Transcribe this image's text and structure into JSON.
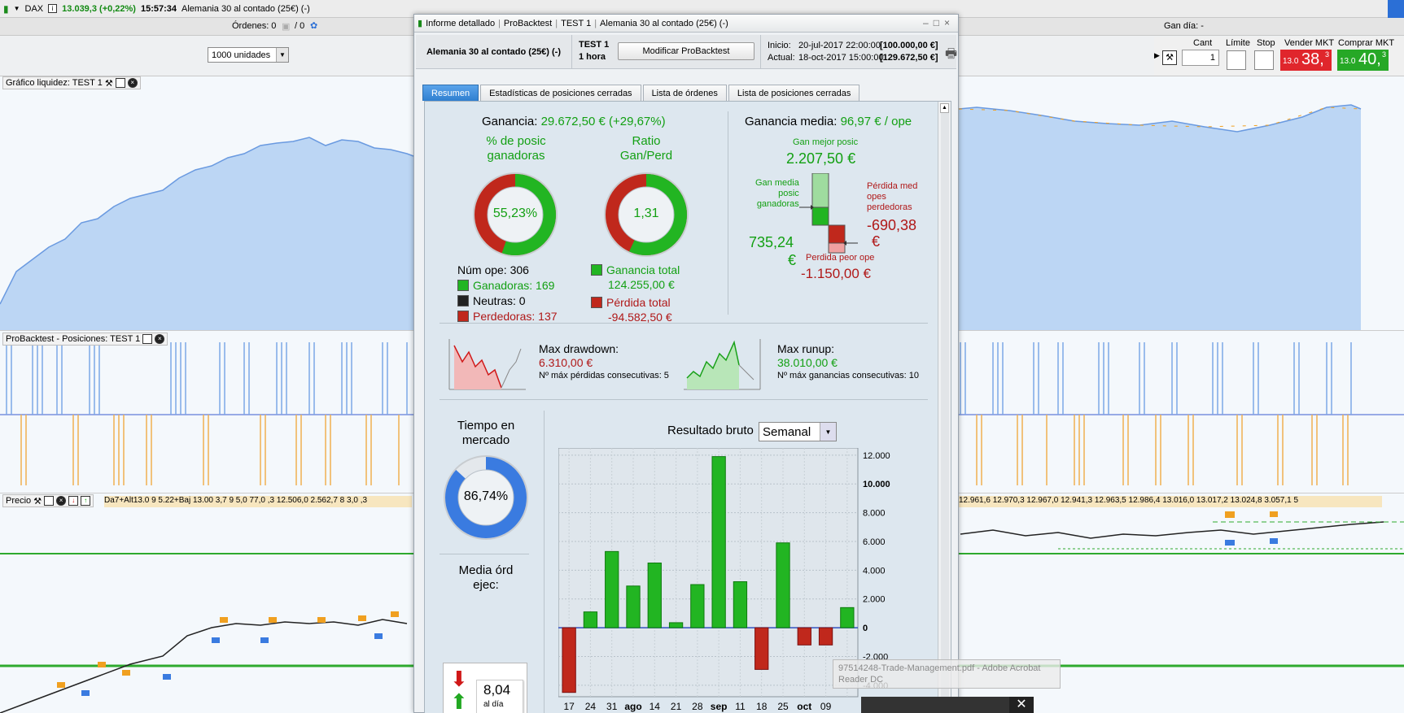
{
  "topbar": {
    "symbol": "DAX",
    "price": "13.039,3 (+0,22%)",
    "time": "15:57:34",
    "instrument": "Alemania 30 al contado (25€) (-)",
    "orders_label": "Órdenes: 0",
    "orders_sep": "/ 0",
    "gan_dia": "Gan día: -"
  },
  "units_select": "1000 unidades",
  "trade": {
    "cant_label": "Cant",
    "cant_value": "1",
    "limite_label": "Límite",
    "stop_label": "Stop",
    "sell_label": "Vender MKT",
    "sell_small": "13.0",
    "sell_big": "38,",
    "sell_sup": "3",
    "buy_label": "Comprar MKT",
    "buy_small": "13.0",
    "buy_big": "40,",
    "buy_sup": "3"
  },
  "panes": {
    "equity_label": "Gráfico liquidez: TEST 1",
    "positions_label": "ProBacktest - Posiciones: TEST 1",
    "price_label": "Precio",
    "price_overlay": "Da7+Alt13.0 9 5.22+Baj 13.00 3,7 9 5,0 77,0 ,3 12.506,0 2.562,7 8 3,0 ,3",
    "price_ticker_right": "12.961,6  12.970,3  12.967,0  12.941,3  12.963,5  12.986,4  13.016,0  13.017,2  13.024,8  3.057,1  5"
  },
  "dialog": {
    "title_parts": [
      "Informe detallado",
      "ProBacktest",
      "TEST 1",
      "Alemania 30 al contado (25€) (-)"
    ],
    "instrument": "Alemania 30 al contado (25€) (-)",
    "test_name": "TEST 1",
    "timeframe": "1 hora",
    "modify_button": "Modificar ProBacktest",
    "inicio_label": "Inicio:",
    "inicio_date": "20-jul-2017 22:00:00",
    "inicio_value": "[100.000,00 €]",
    "actual_label": "Actual:",
    "actual_date": "18-oct-2017 15:00:00",
    "actual_value": "[129.672,50 €]",
    "tabs": [
      "Resumen",
      "Estadísticas de posiciones cerradas",
      "Lista de órdenes",
      "Lista de posiciones cerradas"
    ],
    "ganancia_label": "Ganancia:",
    "ganancia_value": "29.672,50 € (+29,67%)",
    "pct_label_1": "% de posic",
    "pct_label_2": "ganadoras",
    "pct_value": "55,23%",
    "pct_fraction": 0.5523,
    "ratio_label_1": "Ratio",
    "ratio_label_2": "Gan/Perd",
    "ratio_value": "1,31",
    "ratio_fraction": 0.568,
    "num_ope": "Núm ope: 306",
    "ganadoras": "Ganadoras: 169",
    "neutras": "Neutras: 0",
    "perdedoras": "Perdedoras: 137",
    "ganancia_total_label": "Ganancia total",
    "ganancia_total_value": "124.255,00 €",
    "perdida_total_label": "Pérdida total",
    "perdida_total_value": "-94.582,50 €",
    "ganancia_media_label": "Ganancia media:",
    "ganancia_media_value": "96,97 € / ope",
    "gan_mejor_label": "Gan mejor posic",
    "gan_mejor_value": "2.207,50 €",
    "gan_media_label_1": "Gan media",
    "gan_media_label_2": "posic",
    "gan_media_label_3": "ganadoras",
    "gan_media_value_1": "735,24",
    "gan_media_value_2": "€",
    "perdida_med_label_1": "Pérdida med",
    "perdida_med_label_2": "opes",
    "perdida_med_label_3": "perdedoras",
    "perdida_med_value_1": "-690,38",
    "perdida_med_value_2": "€",
    "perdida_peor_label": "Perdida peor ope",
    "perdida_peor_value": "-1.150,00 €",
    "max_drawdown_label": "Max drawdown:",
    "max_drawdown_value": "6.310,00 €",
    "max_perdidas_consec": "Nº máx pérdidas consecutivas: 5",
    "max_runup_label": "Max runup:",
    "max_runup_value": "38.010,00 €",
    "max_ganancias_consec": "Nº máx ganancias consecutivas: 10",
    "tiempo_label_1": "Tiempo en",
    "tiempo_label_2": "mercado",
    "tiempo_value": "86,74%",
    "tiempo_fraction": 0.8674,
    "media_ord_label_1": "Media órd",
    "media_ord_label_2": "ejec:",
    "media_ord_value": "8,04",
    "media_ord_unit": "al día",
    "resultado_label": "Resultado bruto",
    "resultado_select": "Semanal"
  },
  "chart_data": {
    "type": "bar",
    "title": "Resultado bruto",
    "categories": [
      "17",
      "24",
      "31",
      "ago",
      "14",
      "21",
      "28",
      "sep",
      "11",
      "18",
      "25",
      "oct",
      "09"
    ],
    "values": [
      -4500,
      1100,
      5300,
      2900,
      4500,
      350,
      3000,
      11900,
      3200,
      -2900,
      5900,
      -1200,
      -1200,
      1400
    ],
    "x_labels": [
      "17",
      "24",
      "31",
      "ago",
      "14",
      "21",
      "28",
      "sep",
      "11",
      "18",
      "25",
      "oct",
      "09"
    ],
    "ylim": [
      -4800,
      12500
    ],
    "yticks": [
      "12.000",
      "10.000",
      "8.000",
      "6.000",
      "4.000",
      "2.000",
      "0",
      "-2.000",
      "-4.000"
    ],
    "ytick_values": [
      12000,
      10000,
      8000,
      6000,
      4000,
      2000,
      0,
      -2000,
      -4000
    ],
    "grid": true,
    "colors": {
      "positive": "#22b522",
      "negative": "#c0281c"
    }
  },
  "overlay": {
    "pdf_line_1": "97514248-Trade-Management.pdf - Adobe Acrobat",
    "pdf_line_2": "Reader DC"
  },
  "colors": {
    "accent_blue": "#2f7fd0",
    "green": "#22b522",
    "red": "#c0281c"
  }
}
